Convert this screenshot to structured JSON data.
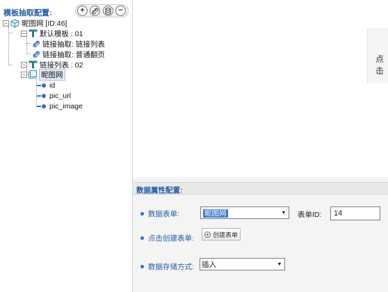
{
  "left_panel": {
    "title": "模板抽取配置:",
    "toolbar": {
      "add_symbol": "+",
      "remove_symbol": "−"
    },
    "tree": {
      "root": "昵图网 [ID:46]",
      "template_group": "默认模板 : 01",
      "link_extract_1": "链接抽取: 链接列表",
      "link_extract_2": "链接抽取: 普通翻页",
      "link_list_group": "链接列表 : 02",
      "table_node": "昵图网",
      "fields": [
        "id",
        "pic_url",
        "pic_image"
      ]
    }
  },
  "right_side": {
    "partial_text": "点击"
  },
  "bottom_panel": {
    "title": "数据属性配置:",
    "form_table_label": "数据表单:",
    "form_table_value": "昵图网",
    "form_id_label": "表单ID:",
    "form_id_value": "14",
    "create_form_label": "点击创建表单:",
    "create_form_button": "创建表单",
    "storage_label": "数据存储方式:",
    "storage_value": "插入"
  },
  "colors": {
    "accent": "#1f5ea8",
    "field_dot": "#2a6fc9",
    "selection": "#3c78d0"
  }
}
